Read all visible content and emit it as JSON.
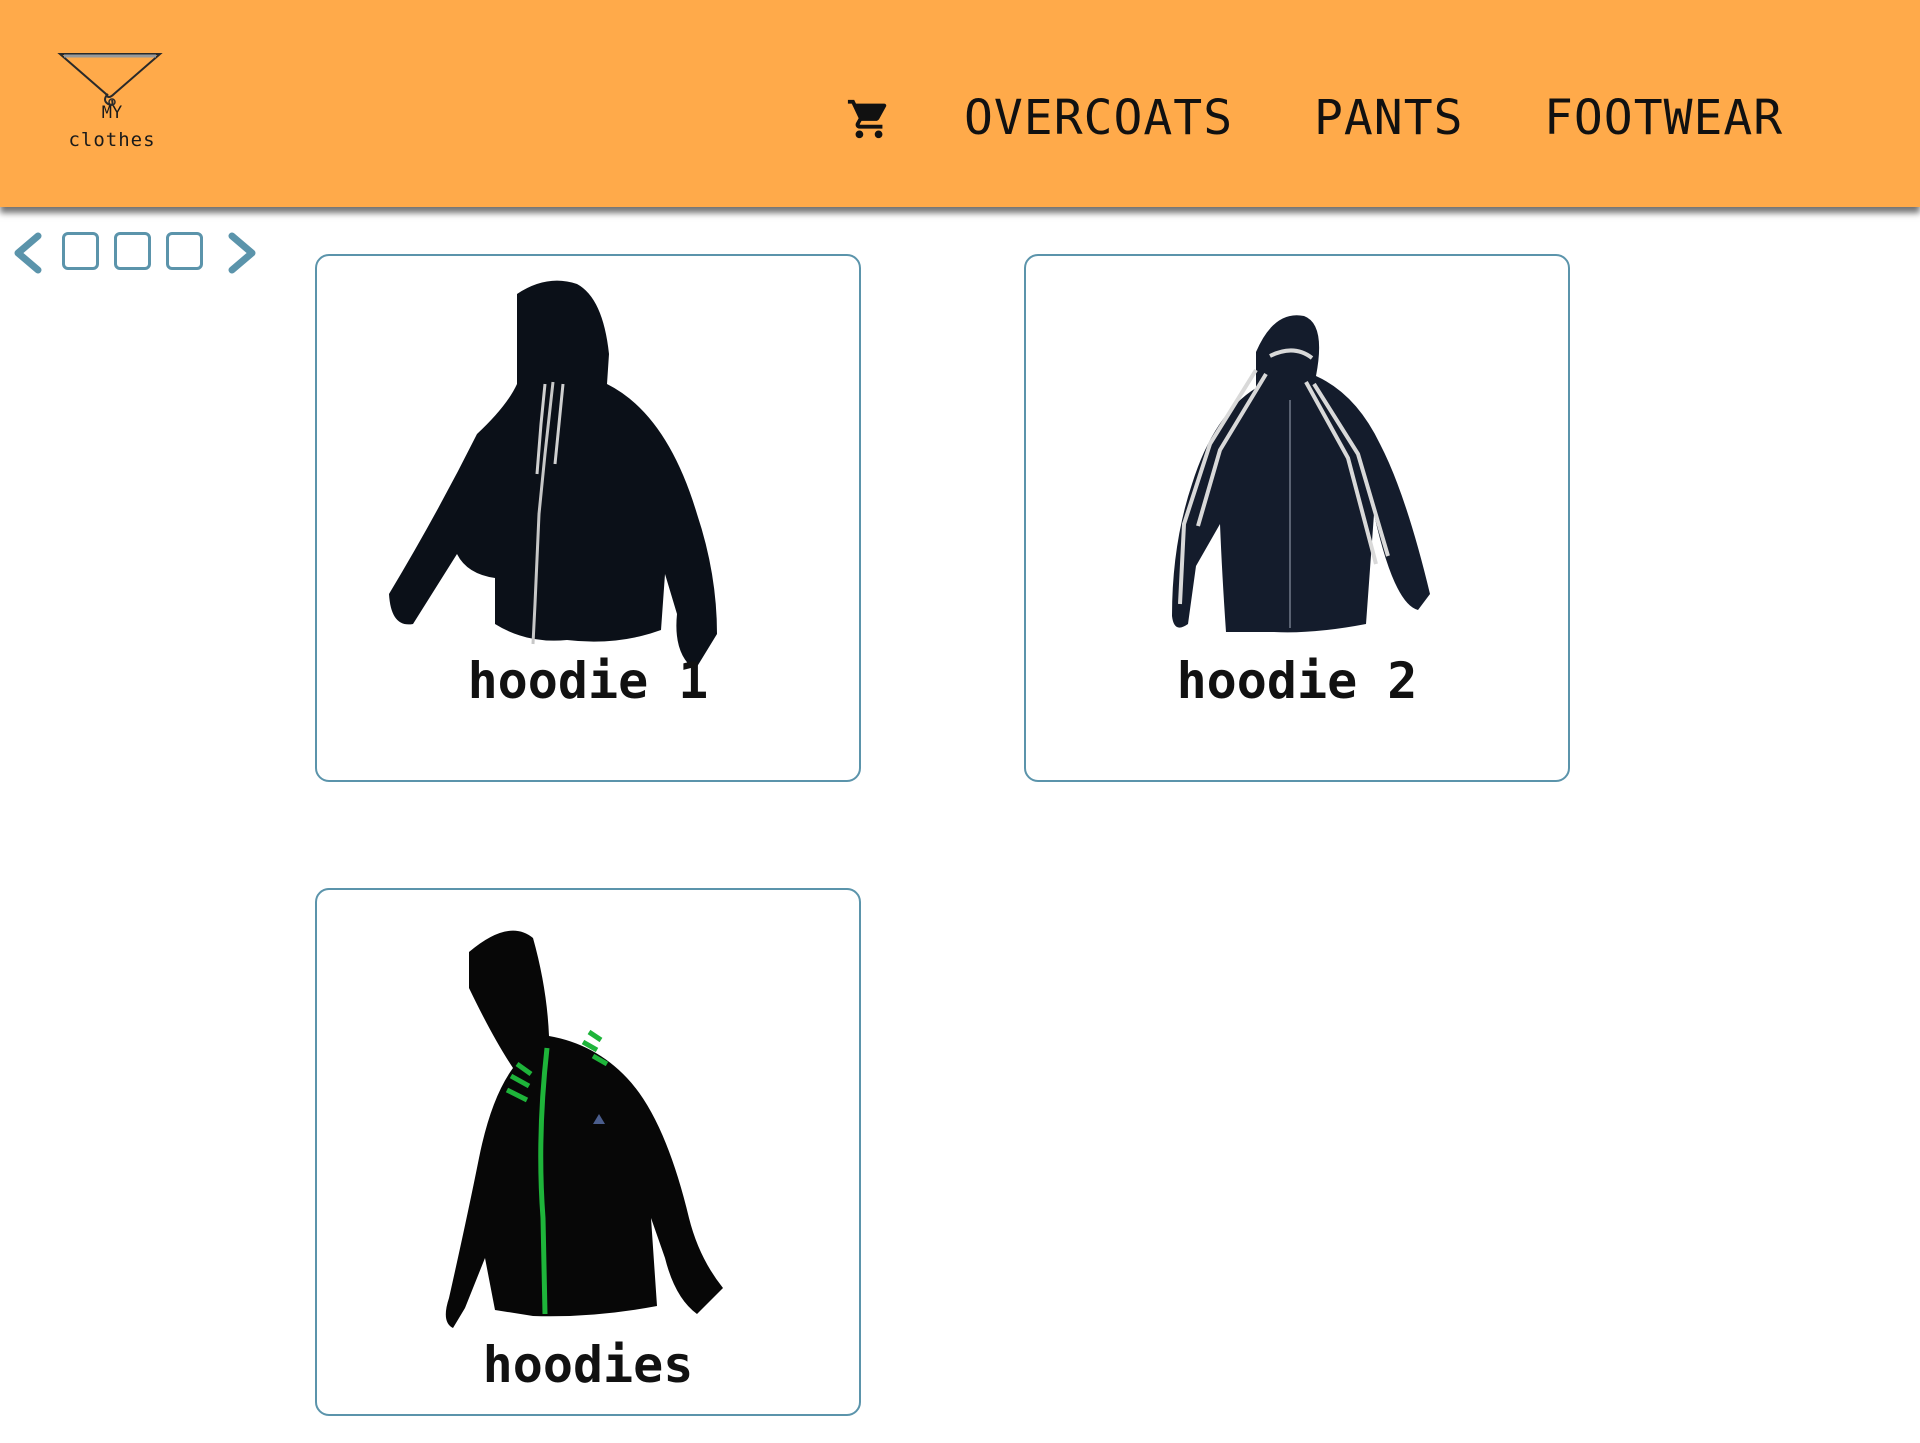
{
  "header": {
    "background": "#ffaa4a",
    "logo": {
      "line1": "MY",
      "line2": "clothes",
      "icon": "hanger-logo-icon"
    },
    "cart_icon": "shopping-cart-icon",
    "nav": [
      {
        "label": "OVERCOATS"
      },
      {
        "label": "PANTS"
      },
      {
        "label": "FOOTWEAR"
      }
    ]
  },
  "pager": {
    "prev_icon": "chevron-left-icon",
    "next_icon": "chevron-right-icon",
    "page_count": 3,
    "accent": "#5b94ab"
  },
  "products": [
    {
      "name": "hoodie 1",
      "image": "black-hoodie-drawstring-icon"
    },
    {
      "name": "hoodie 2",
      "image": "navy-striped-track-jacket-icon"
    },
    {
      "name": "hoodies",
      "image": "black-hoodie-green-zip-icon"
    }
  ]
}
